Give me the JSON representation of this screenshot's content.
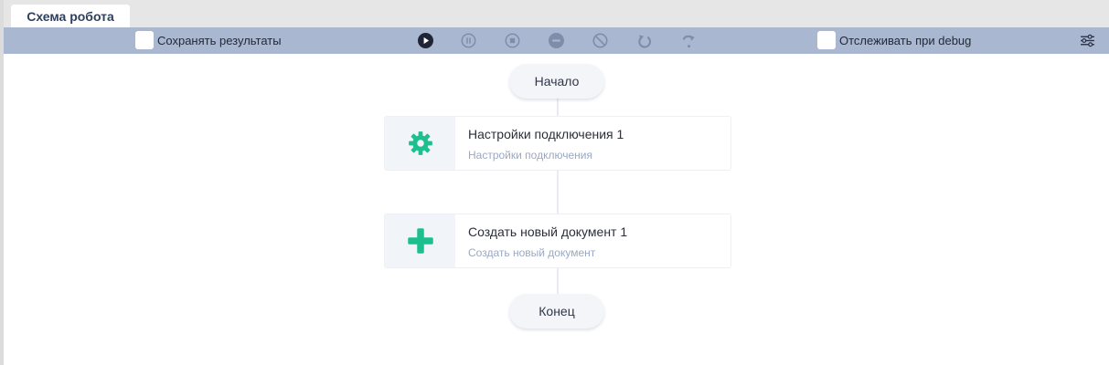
{
  "tabs": [
    {
      "label": "Схема робота"
    }
  ],
  "toolbar": {
    "save_results_label": "Сохранять результаты",
    "debug_trace_label": "Отслеживать при debug",
    "icons": [
      "play-icon",
      "pause-icon",
      "stop-icon",
      "minus-icon",
      "block-icon",
      "undo-icon",
      "redo-icon",
      "settings-sliders-icon"
    ]
  },
  "flow": {
    "start_label": "Начало",
    "end_label": "Конец",
    "nodes": [
      {
        "title": "Настройки подключения 1",
        "subtitle": "Настройки подключения",
        "icon": "gear-icon"
      },
      {
        "title": "Создать новый документ 1",
        "subtitle": "Создать новый документ",
        "icon": "plus-icon"
      }
    ]
  },
  "colors": {
    "toolbar_bg": "#a9b7d0",
    "accent_green": "#1cc08d",
    "tab_text": "#2f3f5c"
  }
}
